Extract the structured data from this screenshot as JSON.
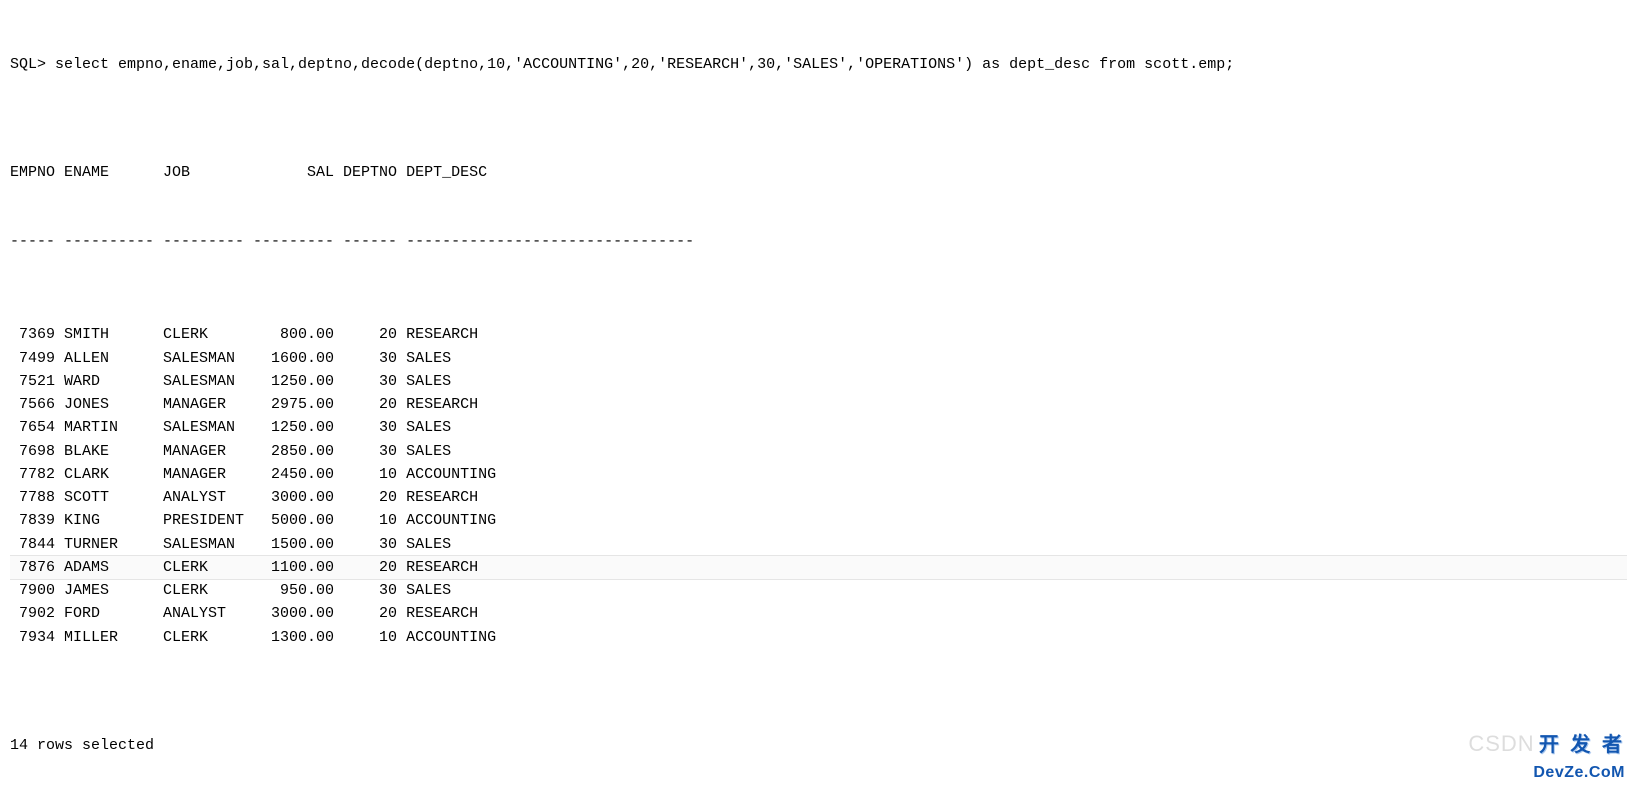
{
  "prompt": "SQL> select empno,ename,job,sal,deptno,decode(deptno,10,'ACCOUNTING',20,'RESEARCH',30,'SALES','OPERATIONS') as dept_desc from scott.emp;",
  "columns": {
    "empno": "EMPNO",
    "ename": "ENAME",
    "job": "JOB",
    "sal": "SAL",
    "deptno": "DEPTNO",
    "dept_desc": "DEPT_DESC"
  },
  "widths": {
    "empno": 5,
    "ename": 10,
    "job": 9,
    "sal": 9,
    "deptno": 6,
    "dept_desc": 32
  },
  "rows": [
    {
      "empno": 7369,
      "ename": "SMITH",
      "job": "CLERK",
      "sal": "800.00",
      "deptno": 20,
      "dept_desc": "RESEARCH",
      "highlight": false
    },
    {
      "empno": 7499,
      "ename": "ALLEN",
      "job": "SALESMAN",
      "sal": "1600.00",
      "deptno": 30,
      "dept_desc": "SALES",
      "highlight": false
    },
    {
      "empno": 7521,
      "ename": "WARD",
      "job": "SALESMAN",
      "sal": "1250.00",
      "deptno": 30,
      "dept_desc": "SALES",
      "highlight": false
    },
    {
      "empno": 7566,
      "ename": "JONES",
      "job": "MANAGER",
      "sal": "2975.00",
      "deptno": 20,
      "dept_desc": "RESEARCH",
      "highlight": false
    },
    {
      "empno": 7654,
      "ename": "MARTIN",
      "job": "SALESMAN",
      "sal": "1250.00",
      "deptno": 30,
      "dept_desc": "SALES",
      "highlight": false
    },
    {
      "empno": 7698,
      "ename": "BLAKE",
      "job": "MANAGER",
      "sal": "2850.00",
      "deptno": 30,
      "dept_desc": "SALES",
      "highlight": false
    },
    {
      "empno": 7782,
      "ename": "CLARK",
      "job": "MANAGER",
      "sal": "2450.00",
      "deptno": 10,
      "dept_desc": "ACCOUNTING",
      "highlight": false
    },
    {
      "empno": 7788,
      "ename": "SCOTT",
      "job": "ANALYST",
      "sal": "3000.00",
      "deptno": 20,
      "dept_desc": "RESEARCH",
      "highlight": false
    },
    {
      "empno": 7839,
      "ename": "KING",
      "job": "PRESIDENT",
      "sal": "5000.00",
      "deptno": 10,
      "dept_desc": "ACCOUNTING",
      "highlight": false
    },
    {
      "empno": 7844,
      "ename": "TURNER",
      "job": "SALESMAN",
      "sal": "1500.00",
      "deptno": 30,
      "dept_desc": "SALES",
      "highlight": false
    },
    {
      "empno": 7876,
      "ename": "ADAMS",
      "job": "CLERK",
      "sal": "1100.00",
      "deptno": 20,
      "dept_desc": "RESEARCH",
      "highlight": true
    },
    {
      "empno": 7900,
      "ename": "JAMES",
      "job": "CLERK",
      "sal": "950.00",
      "deptno": 30,
      "dept_desc": "SALES",
      "highlight": false
    },
    {
      "empno": 7902,
      "ename": "FORD",
      "job": "ANALYST",
      "sal": "3000.00",
      "deptno": 20,
      "dept_desc": "RESEARCH",
      "highlight": false
    },
    {
      "empno": 7934,
      "ename": "MILLER",
      "job": "CLERK",
      "sal": "1300.00",
      "deptno": 10,
      "dept_desc": "ACCOUNTING",
      "highlight": false
    }
  ],
  "footer": "14 rows selected",
  "watermark": {
    "csdn": "CSDN",
    "line1": "开 发 者",
    "line2": "DevZe.CoM"
  }
}
